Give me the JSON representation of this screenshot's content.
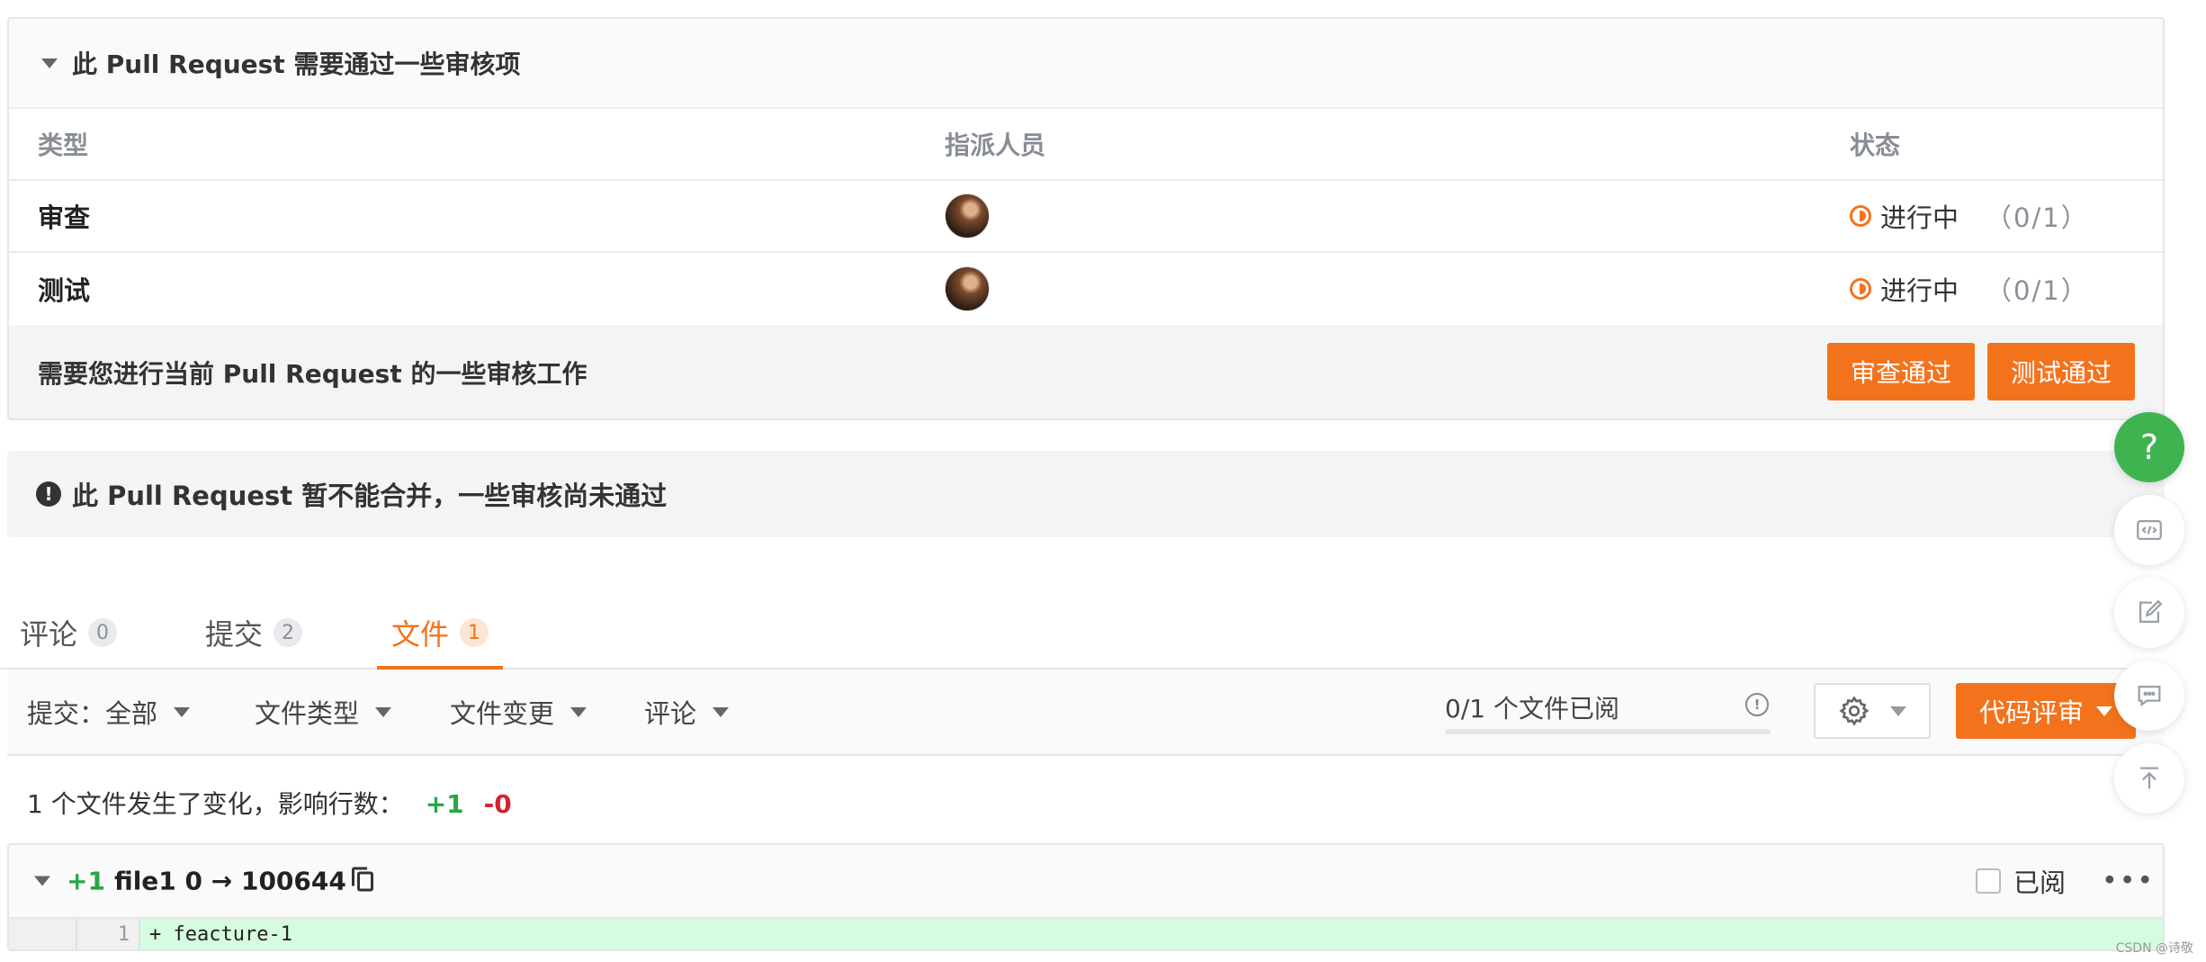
{
  "review": {
    "title": "此 Pull Request 需要通过一些审核项",
    "columns": {
      "type": "类型",
      "assignee": "指派人员",
      "status": "状态"
    },
    "rows": [
      {
        "type": "审查",
        "status": "进行中",
        "count": "（0/1）"
      },
      {
        "type": "测试",
        "status": "进行中",
        "count": "（0/1）"
      }
    ],
    "footer_message": "需要您进行当前 Pull Request 的一些审核工作",
    "approve_review_label": "审查通过",
    "approve_test_label": "测试通过"
  },
  "merge_notice": "此 Pull Request 暂不能合并，一些审核尚未通过",
  "tabs": [
    {
      "label": "评论",
      "count": "0"
    },
    {
      "label": "提交",
      "count": "2"
    },
    {
      "label": "文件",
      "count": "1"
    }
  ],
  "filters": {
    "commit_label": "提交：",
    "commit_value": "全部",
    "file_type": "文件类型",
    "file_change": "文件变更",
    "comment": "评论"
  },
  "progress": {
    "label": "0/1 个文件已阅",
    "value": 0
  },
  "code_review_label": "代码评审",
  "summary": {
    "text": "1 个文件发生了变化，影响行数：",
    "additions": "+1",
    "deletions": "-0"
  },
  "file": {
    "additions": "+1",
    "name": "file1 0 → 100644",
    "viewed_label": "已阅",
    "lines": [
      {
        "new_number": "1",
        "content": "+ feacture-1"
      }
    ]
  },
  "watermark": "CSDN @诗敬",
  "colors": {
    "accent": "#f3731c",
    "success": "#3fb34f",
    "added": "#28a745",
    "removed": "#d1242f"
  },
  "icons": [
    "help-icon",
    "code-icon",
    "edit-icon",
    "comment-icon",
    "back-to-top-icon",
    "gear-icon",
    "info-icon",
    "copy-icon",
    "more-icon"
  ]
}
